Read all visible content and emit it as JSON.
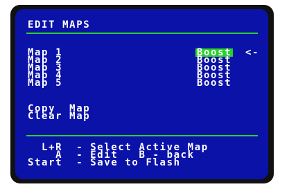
{
  "header": {
    "title": "EDIT MAPS"
  },
  "maps": [
    {
      "label": "Map 1",
      "value": "Boost",
      "selected": true
    },
    {
      "label": "Map 2",
      "value": "Boost",
      "selected": false
    },
    {
      "label": "Map 3",
      "value": "Boost",
      "selected": false
    },
    {
      "label": "Map 4",
      "value": "Boost",
      "selected": false
    },
    {
      "label": "Map 5",
      "value": "Boost",
      "selected": false
    }
  ],
  "cursor": "<-",
  "actions": [
    "Copy  Map",
    "Clear Map"
  ],
  "help": [
    "  L+R  - Select Active Map",
    "    A  - Edit   B - back",
    "Start  - Save to Flash"
  ],
  "colors": {
    "screen_bg": "#0b12a8",
    "accent_green": "#2ad12a",
    "text": "#ffffff",
    "bezel": "#111111"
  }
}
